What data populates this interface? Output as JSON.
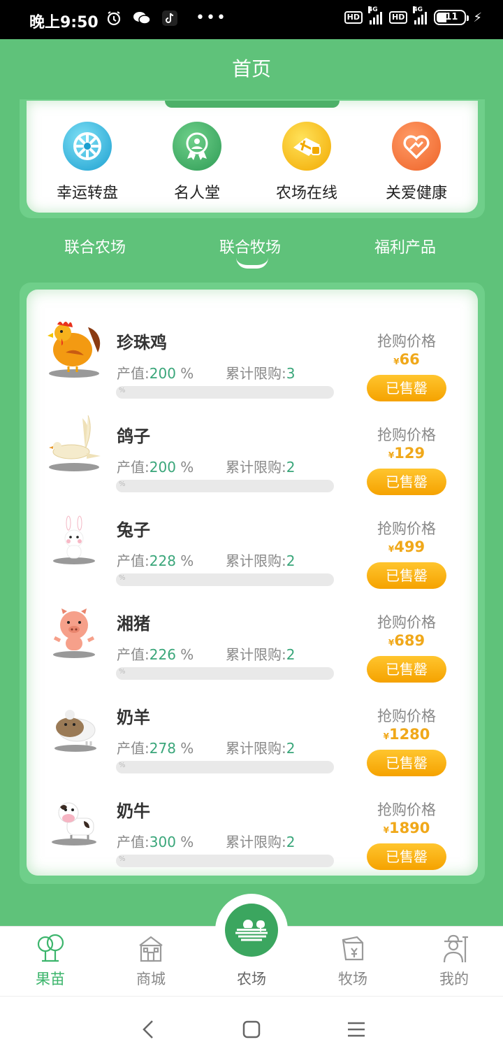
{
  "status_bar": {
    "time": "晚上9:50",
    "hd1": "HD",
    "net1": "4G",
    "hd2": "HD",
    "net2": "4G",
    "battery": "11"
  },
  "header": {
    "title": "首页"
  },
  "quick_menu": [
    {
      "label": "幸运转盘",
      "icon": "wheel-icon",
      "color": "#2fb0d6"
    },
    {
      "label": "名人堂",
      "icon": "medal-icon",
      "color": "#3aa65c"
    },
    {
      "label": "农场在线",
      "icon": "farm-online-icon",
      "color": "#f5b800"
    },
    {
      "label": "关爱健康",
      "icon": "heart-hand-icon",
      "color": "#f07238"
    }
  ],
  "category_tabs": [
    {
      "label": "联合农场",
      "active": false
    },
    {
      "label": "联合牧场",
      "active": true
    },
    {
      "label": "福利产品",
      "active": false
    }
  ],
  "products": [
    {
      "name": "珍珠鸡",
      "value_label": "产值:",
      "value": "200",
      "unit": "%",
      "limit_label": "累计限购:",
      "limit": "3",
      "progress_text": "%",
      "price_label": "抢购价格",
      "currency": "¥",
      "price": "66",
      "button": "已售罄",
      "animal": "rooster-icon"
    },
    {
      "name": "鸽子",
      "value_label": "产值:",
      "value": "200",
      "unit": "%",
      "limit_label": "累计限购:",
      "limit": "2",
      "progress_text": "%",
      "price_label": "抢购价格",
      "currency": "¥",
      "price": "129",
      "button": "已售罄",
      "animal": "dove-icon"
    },
    {
      "name": "兔子",
      "value_label": "产值:",
      "value": "228",
      "unit": "%",
      "limit_label": "累计限购:",
      "limit": "2",
      "progress_text": "%",
      "price_label": "抢购价格",
      "currency": "¥",
      "price": "499",
      "button": "已售罄",
      "animal": "rabbit-icon"
    },
    {
      "name": "湘猪",
      "value_label": "产值:",
      "value": "226",
      "unit": "%",
      "limit_label": "累计限购:",
      "limit": "2",
      "progress_text": "%",
      "price_label": "抢购价格",
      "currency": "¥",
      "price": "689",
      "button": "已售罄",
      "animal": "pig-icon"
    },
    {
      "name": "奶羊",
      "value_label": "产值:",
      "value": "278",
      "unit": "%",
      "limit_label": "累计限购:",
      "limit": "2",
      "progress_text": "%",
      "price_label": "抢购价格",
      "currency": "¥",
      "price": "1280",
      "button": "已售罄",
      "animal": "sheep-icon"
    },
    {
      "name": "奶牛",
      "value_label": "产值:",
      "value": "300",
      "unit": "%",
      "limit_label": "累计限购:",
      "limit": "2",
      "progress_text": "%",
      "price_label": "抢购价格",
      "currency": "¥",
      "price": "1890",
      "button": "已售罄",
      "animal": "cow-icon"
    }
  ],
  "bottom_nav": [
    {
      "label": "果苗",
      "icon": "tree-icon",
      "active": true
    },
    {
      "label": "商城",
      "icon": "shop-icon",
      "active": false
    },
    {
      "label": "农场",
      "icon": "field-icon",
      "active": false
    },
    {
      "label": "牧场",
      "icon": "ranch-icon",
      "active": false
    },
    {
      "label": "我的",
      "icon": "farmer-icon",
      "active": false
    }
  ],
  "colors": {
    "primary_green": "#5fc27a",
    "accent_orange": "#f5a200",
    "value_green": "#3aa67a"
  }
}
